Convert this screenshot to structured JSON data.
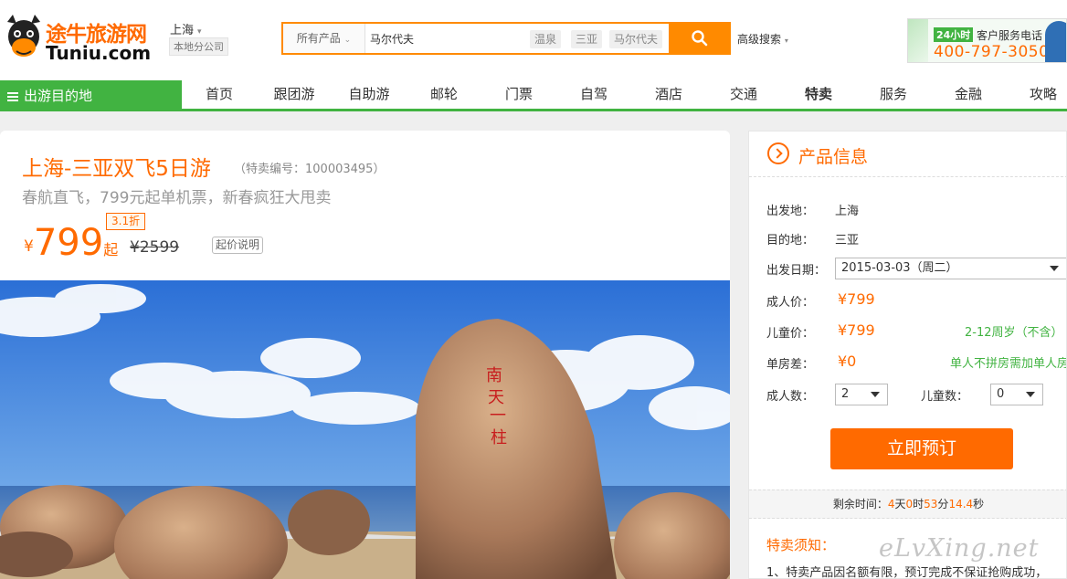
{
  "header": {
    "logo_cn": "途牛旅游网",
    "logo_en": "Tuniu.com",
    "city": "上海",
    "branch": "本地分公司",
    "search": {
      "category": "所有产品",
      "value": "马尔代夫",
      "tags": [
        "温泉",
        "三亚",
        "马尔代夫"
      ]
    },
    "advanced_search": "高级搜索",
    "hotline": {
      "tag": "24小时",
      "label": "客户服务电话",
      "number": "400-797-3050"
    }
  },
  "nav": {
    "destinations": "出游目的地",
    "items": [
      "首页",
      "跟团游",
      "自助游",
      "邮轮",
      "门票",
      "自驾",
      "酒店",
      "交通",
      "特卖",
      "服务",
      "金融",
      "攻略"
    ]
  },
  "product": {
    "title": "上海-三亚双飞5日游",
    "code": "（特卖编号：100003495）",
    "subtitle": "春航直飞，799元起单机票，新春疯狂大甩卖",
    "discount": "3.1折",
    "currency": "¥",
    "price": "799",
    "price_suffix": "起",
    "original_price": "¥2599",
    "price_note": "起价说明",
    "photo_inscription": "南天一柱"
  },
  "info": {
    "title": "产品信息",
    "departure_label": "出发地：",
    "departure": "上海",
    "destination_label": "目的地：",
    "destination": "三亚",
    "date_label": "出发日期：",
    "date": "2015-03-03（周二）",
    "adult_price_label": "成人价：",
    "adult_price": "¥799",
    "child_price_label": "儿童价：",
    "child_price": "¥799",
    "child_note": "2-12周岁（不含）",
    "single_label": "单房差：",
    "single_price": "¥0",
    "single_note": "单人不拼房需加单人房",
    "adults_label": "成人数：",
    "adults": "2",
    "children_label": "儿童数：",
    "children": "0",
    "book_button": "立即预订",
    "countdown": {
      "label": "剩余时间：",
      "days": "4",
      "days_unit": "天",
      "hours": "0",
      "hours_unit": "时",
      "minutes": "53",
      "minutes_unit": "分",
      "seconds": "14.4",
      "seconds_unit": "秒"
    },
    "notice_title": "特卖须知：",
    "notice_1": "1、特卖产品因名额有限，预订完成不保证抢购成功，"
  },
  "watermark": "eLvXing.net",
  "colors": {
    "brand_orange": "#ff6a00",
    "brand_green": "#41b341"
  }
}
